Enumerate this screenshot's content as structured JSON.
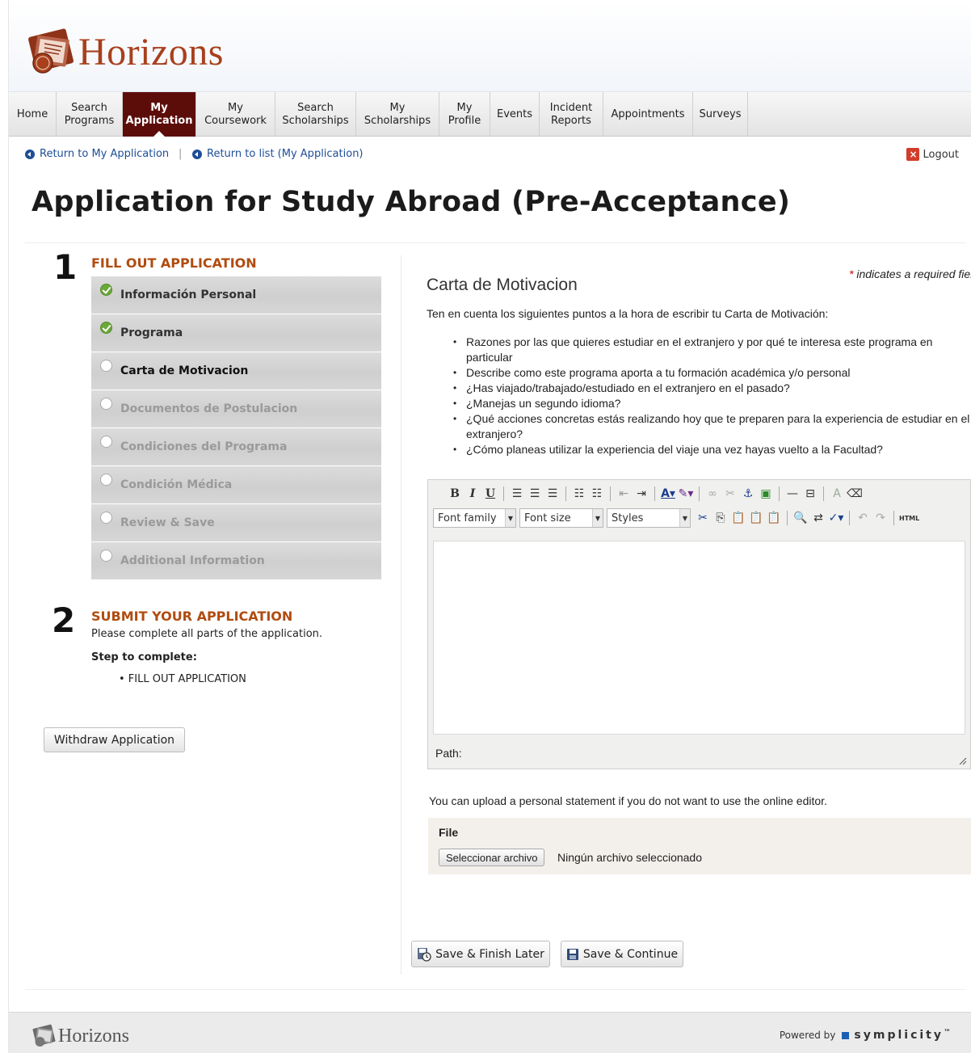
{
  "brand": {
    "name": "Horizons"
  },
  "nav": [
    {
      "label": "Home",
      "active": false
    },
    {
      "label": "Search\nPrograms",
      "active": false
    },
    {
      "label": "My\nApplication",
      "active": true
    },
    {
      "label": "My\nCoursework",
      "active": false
    },
    {
      "label": "Search\nScholarships",
      "active": false
    },
    {
      "label": "My\nScholarships",
      "active": false
    },
    {
      "label": "My\nProfile",
      "active": false
    },
    {
      "label": "Events",
      "active": false
    },
    {
      "label": "Incident\nReports",
      "active": false
    },
    {
      "label": "Appointments",
      "active": false
    },
    {
      "label": "Surveys",
      "active": false
    }
  ],
  "breadcrumbs": {
    "return_app": "Return to My Application",
    "separator": "|",
    "return_list": "Return to list (My Application)",
    "logout": "Logout"
  },
  "page_title": "Application for Study Abroad (Pre-Acceptance)",
  "step1": {
    "number": "1",
    "title": "FILL OUT APPLICATION",
    "items": [
      {
        "label": "Información Personal",
        "status": "done"
      },
      {
        "label": "Programa",
        "status": "done"
      },
      {
        "label": "Carta de Motivacion",
        "status": "current"
      },
      {
        "label": "Documentos de Postulacion",
        "status": "todo"
      },
      {
        "label": "Condiciones del Programa",
        "status": "todo"
      },
      {
        "label": "Condición Médica",
        "status": "todo"
      },
      {
        "label": "Review & Save",
        "status": "todo"
      },
      {
        "label": "Additional Information",
        "status": "todo"
      }
    ]
  },
  "step2": {
    "number": "2",
    "title": "SUBMIT YOUR APPLICATION",
    "text": "Please complete all parts of the application.",
    "step_label": "Step to complete:",
    "step_item": "• FILL OUT APPLICATION"
  },
  "withdraw_label": "Withdraw Application",
  "form": {
    "required_star": "*",
    "required_note": " indicates a required field",
    "section_title": "Carta de Motivacion",
    "intro": "Ten en cuenta los siguientes puntos a la hora de escribir tu Carta de Motivación:",
    "bullets": [
      "Razones por las que quieres estudiar en el extranjero y por qué te interesa este programa en particular",
      "Describe como este programa aporta a tu formación académica y/o personal",
      "¿Has viajado/trabajado/estudiado en el extranjero en el pasado?",
      "¿Manejas un segundo idioma?",
      "¿Qué acciones concretas estás realizando hoy que te preparen para la experiencia de estudiar en el extranjero?",
      "¿Cómo planeas utilizar la experiencia del viaje una vez hayas vuelto a la Facultad?"
    ],
    "editor": {
      "font_family": "Font family",
      "font_size": "Font size",
      "styles": "Styles",
      "path_label": "Path:"
    },
    "upload_note": "You can upload a personal statement if you do not want to use the online editor.",
    "file_label": "File",
    "file_button": "Seleccionar archivo",
    "file_status": "Ningún archivo seleccionado",
    "save_later": "Save & Finish Later",
    "save_continue": "Save & Continue"
  },
  "footer": {
    "brand": "Horizons",
    "powered_by": "Powered by",
    "vendor": "symplicity",
    "tm": "™"
  },
  "colors": {
    "accent": "#5c0d0a",
    "brand": "#a8401c",
    "step_title": "#b04c10",
    "link": "#1d4e96"
  }
}
